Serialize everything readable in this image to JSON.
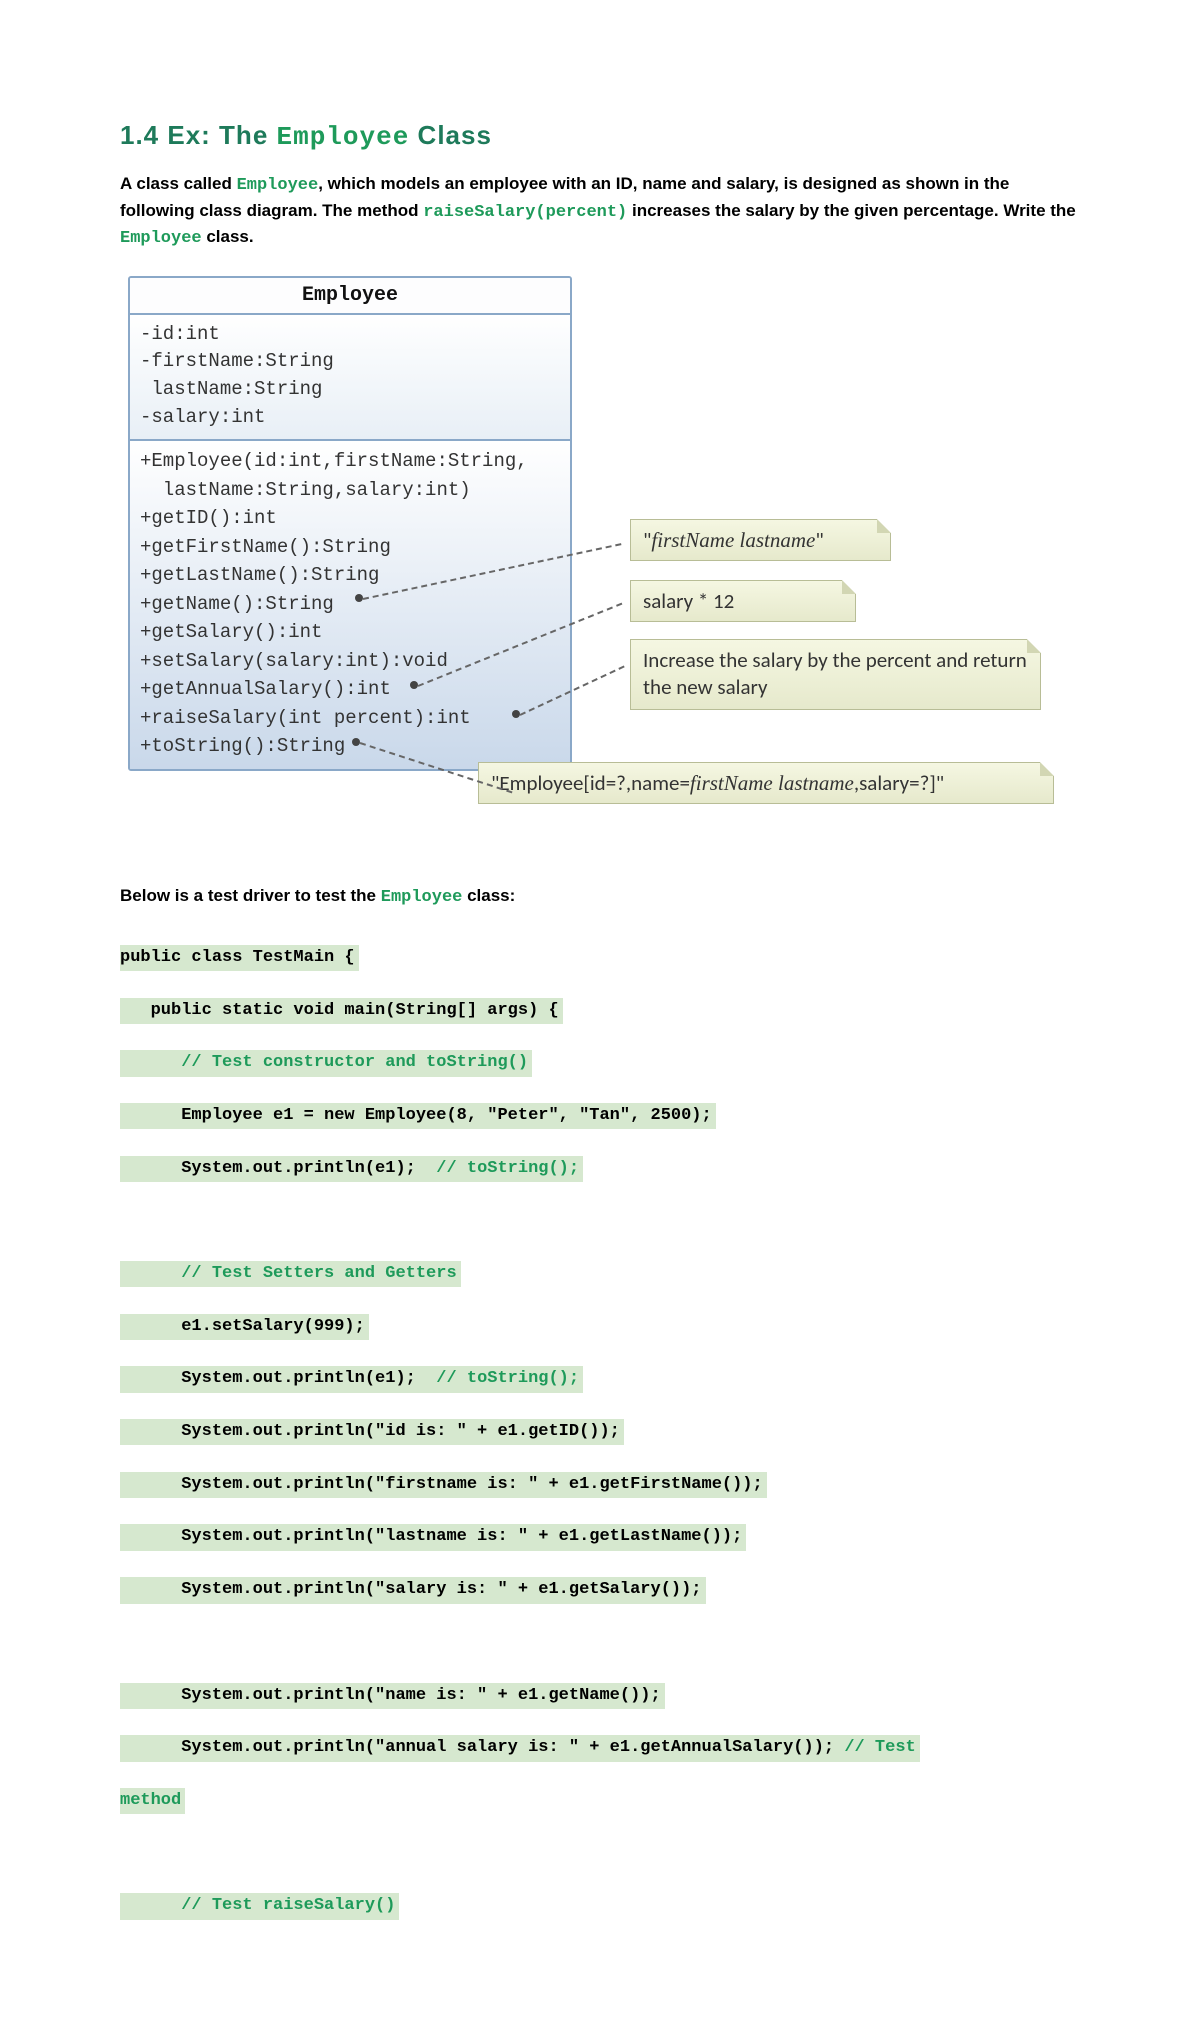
{
  "heading": {
    "prefix": "1.4  Ex: The ",
    "code": "Employee",
    "suffix": " Class"
  },
  "intro": {
    "t1": "A class called ",
    "kw1": "Employee",
    "t2": ", which models an employee with an ID, name and salary, is designed as shown in the following class diagram. The method ",
    "kw2": "raiseSalary(percent)",
    "t3": " increases the salary by the given percentage. Write the ",
    "kw3": "Employee",
    "t4": " class."
  },
  "uml": {
    "title": "Employee",
    "attrs": "-id:int\n-firstName:String\n lastName:String\n-salary:int",
    "methods": "+Employee(id:int,firstName:String,\n  lastName:String,salary:int)\n+getID():int\n+getFirstName():String\n+getLastName():String\n+getName():String\n+getSalary():int\n+setSalary(salary:int):void\n+getAnnualSalary():int\n+raiseSalary(int percent):int\n+toString():String"
  },
  "notes": {
    "n1a": "\"",
    "n1b": "firstName lastname",
    "n1c": "\"",
    "n2": "salary * 12",
    "n3": "Increase the salary by the percent and return the new salary",
    "n4a": "\"Employee[id=?,name=",
    "n4b": "firstName lastname",
    "n4c": ",salary=?]\""
  },
  "subintro": {
    "t1": "Below is a test driver to test the ",
    "kw": "Employee",
    "t2": " class:"
  },
  "code": {
    "l01": "public class TestMain {",
    "l02": "   public static void main(String[] args) {",
    "l03": "      // Test constructor and toString()",
    "l04": "      Employee e1 = new Employee(8, \"Peter\", \"Tan\", 2500);",
    "l05a": "      System.out.println(e1);  ",
    "l05b": "// toString();",
    "blank1": " ",
    "l06": "      // Test Setters and Getters",
    "l07": "      e1.setSalary(999);",
    "l08a": "      System.out.println(e1);  ",
    "l08b": "// toString();",
    "l09": "      System.out.println(\"id is: \" + e1.getID());",
    "l10": "      System.out.println(\"firstname is: \" + e1.getFirstName());",
    "l11": "      System.out.println(\"lastname is: \" + e1.getLastName());",
    "l12": "      System.out.println(\"salary is: \" + e1.getSalary());",
    "blank2": " ",
    "l13": "      System.out.println(\"name is: \" + e1.getName());",
    "l14a": "      System.out.println(\"annual salary is: \" + e1.getAnnualSalary()); ",
    "l14b": "// Test",
    "l15": "method",
    "blank3": " ",
    "l16": "      // Test raiseSalary()"
  }
}
